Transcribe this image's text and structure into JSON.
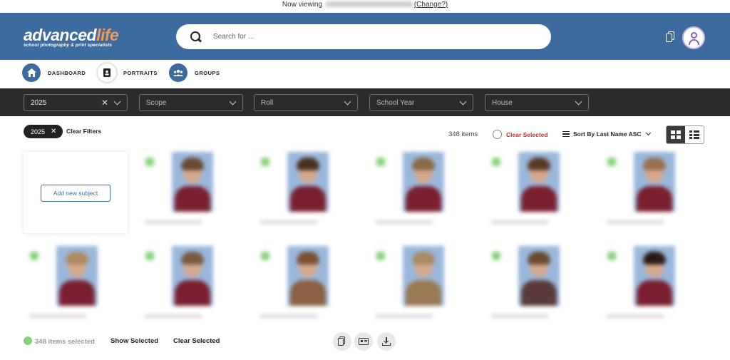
{
  "top_notice": {
    "prefix": "Now viewing",
    "change_link": "(Change?)"
  },
  "brand": {
    "logo_part1": "advanced",
    "logo_part2": "life",
    "tagline": "school photography & print specialists",
    "accent_color": "#f39a55",
    "header_color": "#3c6ba0"
  },
  "search": {
    "placeholder": "Search for ..."
  },
  "header_icons": [
    "copy-icon",
    "user-avatar-icon"
  ],
  "nav": [
    {
      "label": "DASHBOARD",
      "icon": "home-icon",
      "active": false
    },
    {
      "label": "PORTRAITS",
      "icon": "portrait-icon",
      "active": true
    },
    {
      "label": "GROUPS",
      "icon": "group-icon",
      "active": false
    }
  ],
  "filters": {
    "year": {
      "value": "2025"
    },
    "scope": {
      "placeholder": "Scope"
    },
    "roll": {
      "placeholder": "Roll"
    },
    "school_year": {
      "placeholder": "School Year"
    },
    "house": {
      "placeholder": "House"
    }
  },
  "active_filter_chip": {
    "label": "2025"
  },
  "clear_filters_label": "Clear Filters",
  "toolbar": {
    "item_count": "348 items",
    "clear_selected_label": "Clear Selected",
    "sort_label": "Sort By Last Name ASC",
    "view_mode": "grid"
  },
  "add_subject_label": "Add new subject",
  "bottom_bar": {
    "selected_count": "348 items selected",
    "show_selected_label": "Show Selected",
    "clear_selected_label": "Clear Selected",
    "action_icons": [
      "copy-icon",
      "id-card-icon",
      "download-icon"
    ]
  },
  "selected_indicator_color": "#86d27a"
}
